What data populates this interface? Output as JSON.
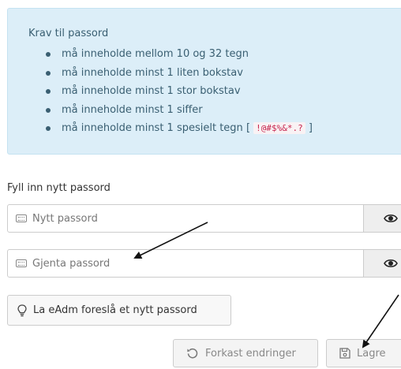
{
  "requirements": {
    "title": "Krav til passord",
    "items": [
      "må inneholde mellom 10 og 32 tegn",
      "må inneholde minst 1 liten bokstav",
      "må inneholde minst 1 stor bokstav",
      "må inneholde minst 1 siffer",
      "må inneholde minst 1 spesielt tegn"
    ],
    "special_chars": "!@#$%&*.?",
    "bracket_open": "[",
    "bracket_close": "]"
  },
  "form": {
    "label": "Fyll inn nytt passord",
    "new_password": {
      "value": "",
      "placeholder": "Nytt passord"
    },
    "repeat_password": {
      "value": "",
      "placeholder": "Gjenta passord"
    }
  },
  "buttons": {
    "suggest": "La eAdm foreslå et nytt passord",
    "discard": "Forkast endringer",
    "save": "Lagre"
  },
  "icons": {
    "field": "keyboard-icon",
    "toggle": "eye-icon",
    "suggest": "lightbulb-icon",
    "discard": "undo-icon",
    "save": "floppy-disk-icon"
  },
  "colors": {
    "info_bg": "#dceef8",
    "info_text": "#3a5f72",
    "code_text": "#c7254e",
    "addon_bg": "#eeeeee"
  }
}
